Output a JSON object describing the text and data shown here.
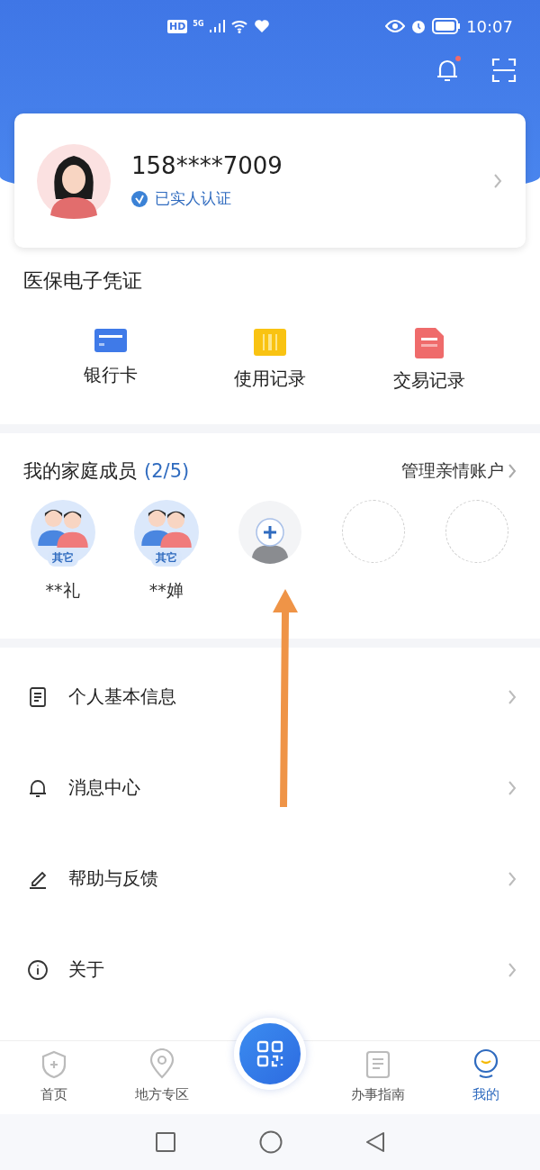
{
  "status_bar": {
    "badge": "HD",
    "network": "5G",
    "time": "10:07"
  },
  "header": {
    "notification_dot": true
  },
  "profile": {
    "phone": "158****7009",
    "verified": true,
    "verified_label": "已实人认证"
  },
  "voucher": {
    "title": "医保电子凭证",
    "items": [
      {
        "kind": "card",
        "label": "银行卡"
      },
      {
        "kind": "usage",
        "label": "使用记录"
      },
      {
        "kind": "trade",
        "label": "交易记录"
      }
    ]
  },
  "family": {
    "title": "我的家庭成员",
    "count": "(2/5)",
    "manage_link": "管理亲情账户",
    "members": [
      {
        "kind": "member",
        "tag": "其它",
        "name": "**礼"
      },
      {
        "kind": "member",
        "tag": "其它",
        "name": "**婵"
      },
      {
        "kind": "add"
      },
      {
        "kind": "empty"
      },
      {
        "kind": "empty"
      }
    ]
  },
  "menu": [
    {
      "kind": "doc",
      "label": "个人基本信息"
    },
    {
      "kind": "bell",
      "label": "消息中心"
    },
    {
      "kind": "pen",
      "label": "帮助与反馈"
    },
    {
      "kind": "info",
      "label": "关于"
    }
  ],
  "tab_bar": {
    "tabs": [
      {
        "kind": "home",
        "label": "首页",
        "selected": false
      },
      {
        "kind": "map",
        "label": "地方专区",
        "selected": false
      },
      {
        "kind": "scan"
      },
      {
        "kind": "guide",
        "label": "办事指南",
        "selected": false
      },
      {
        "kind": "mine",
        "label": "我的",
        "selected": true
      }
    ]
  }
}
